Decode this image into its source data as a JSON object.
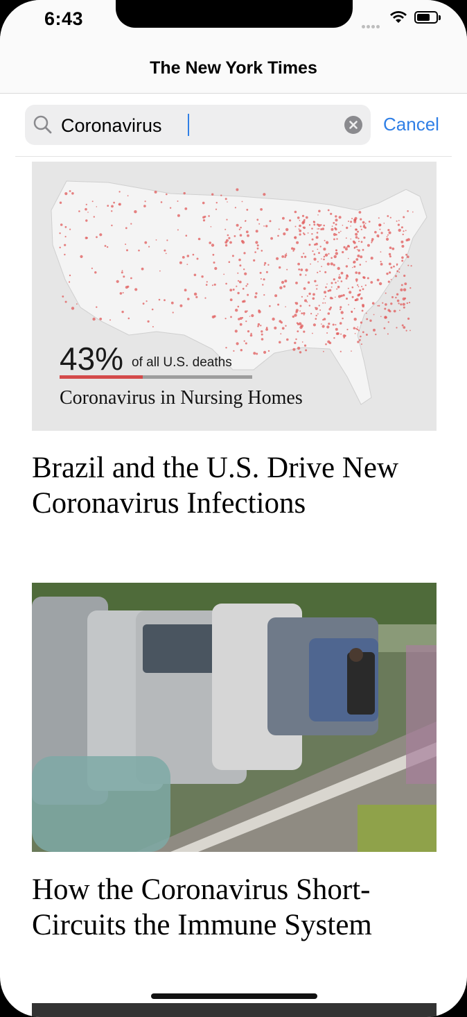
{
  "status_bar": {
    "time": "6:43"
  },
  "header": {
    "title": "The New York Times"
  },
  "search": {
    "value": "Coronavirus",
    "cancel_label": "Cancel"
  },
  "articles": [
    {
      "image": {
        "stat_value": "43%",
        "stat_label": "of all U.S. deaths",
        "stat_fraction": 0.43,
        "caption": "Coronavirus in Nursing Homes"
      },
      "headline": "Brazil and the U.S. Drive New Coronavirus Infections"
    },
    {
      "headline": "How the Coronavirus Short-Circuits the Immune System"
    }
  ],
  "colors": {
    "accent": "#2f7fe6",
    "map_dots": "#e05a5a",
    "stat_bar": "#d44a4a"
  }
}
